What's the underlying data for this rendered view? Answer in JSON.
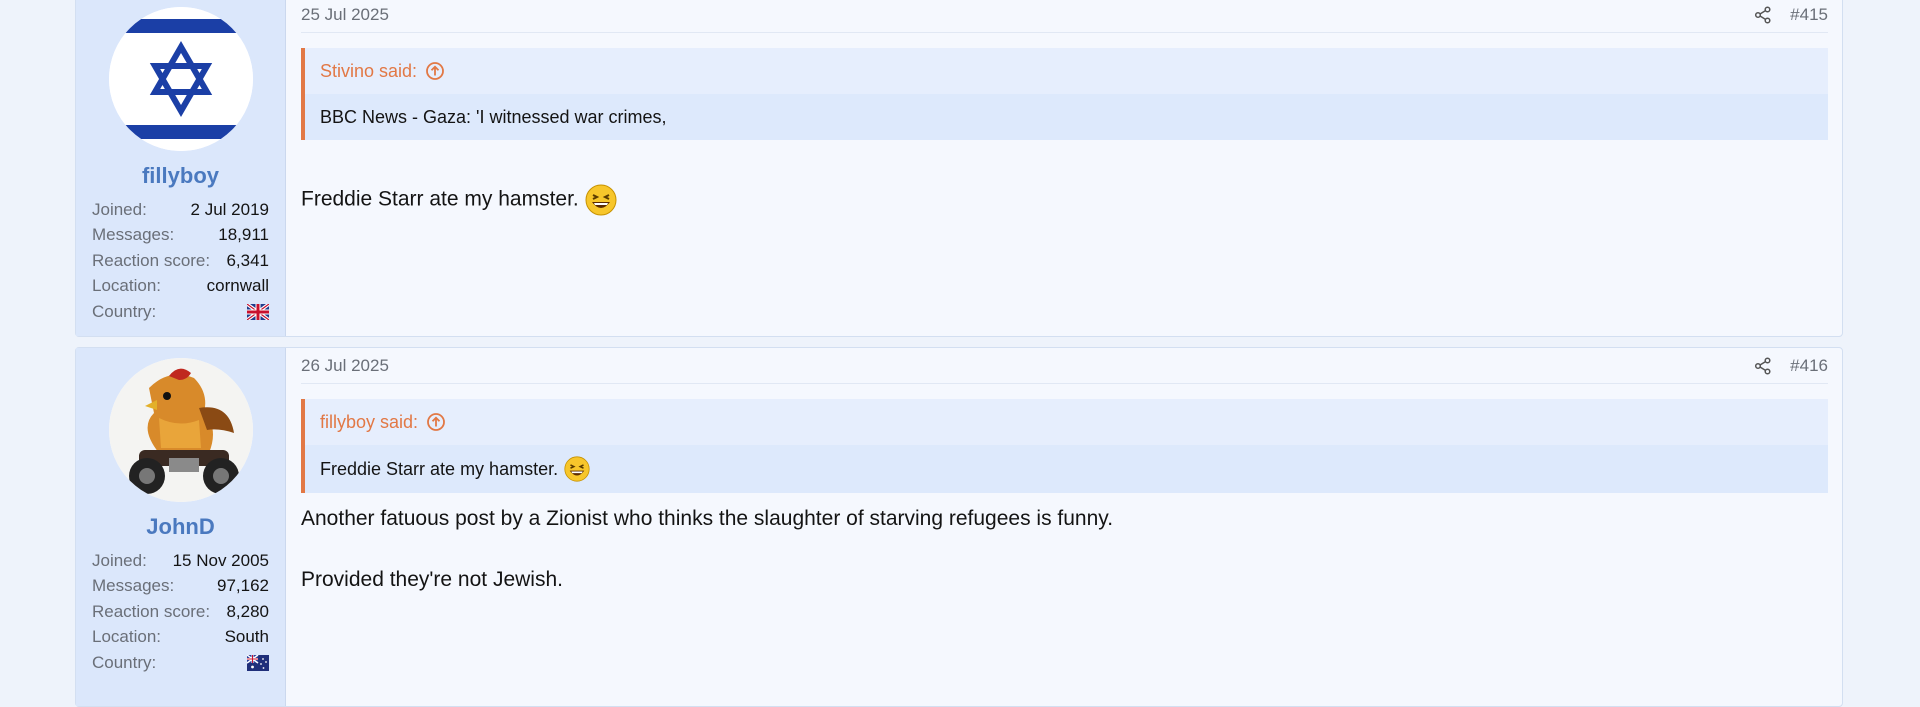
{
  "posts": [
    {
      "date": "25 Jul 2025",
      "number": "#415",
      "username": "fillyboy",
      "avatar": "israel-flag-avatar",
      "stats": {
        "joined_label": "Joined:",
        "joined": "2 Jul 2019",
        "messages_label": "Messages:",
        "messages": "18,911",
        "reaction_label": "Reaction score:",
        "reaction": "6,341",
        "location_label": "Location:",
        "location": "cornwall",
        "country_label": "Country:",
        "country_icon": "uk-flag-icon"
      },
      "quote": {
        "author": "Stivino said:",
        "text": "BBC News - Gaza: 'I witnessed war crimes,"
      },
      "body": [
        "Freddie Starr ate my hamster."
      ],
      "emoji": "laughing-emoji"
    },
    {
      "date": "26 Jul 2025",
      "number": "#416",
      "username": "JohnD",
      "avatar": "rooster-motorbike-avatar",
      "stats": {
        "joined_label": "Joined:",
        "joined": "15 Nov 2005",
        "messages_label": "Messages:",
        "messages": "97,162",
        "reaction_label": "Reaction score:",
        "reaction": "8,280",
        "location_label": "Location:",
        "location": "South",
        "country_label": "Country:",
        "country_icon": "australia-flag-icon"
      },
      "quote": {
        "author": "fillyboy said:",
        "text": "Freddie Starr ate my hamster."
      },
      "body": [
        "Another fatuous post by a Zionist who thinks the slaughter of starving refugees is funny.",
        "Provided they're not Jewish."
      ],
      "emoji": "laughing-emoji"
    }
  ],
  "colors": {
    "accent_orange": "#e27845",
    "username_blue": "#4a79bf",
    "sidebar_bg": "#dbe7fb"
  }
}
